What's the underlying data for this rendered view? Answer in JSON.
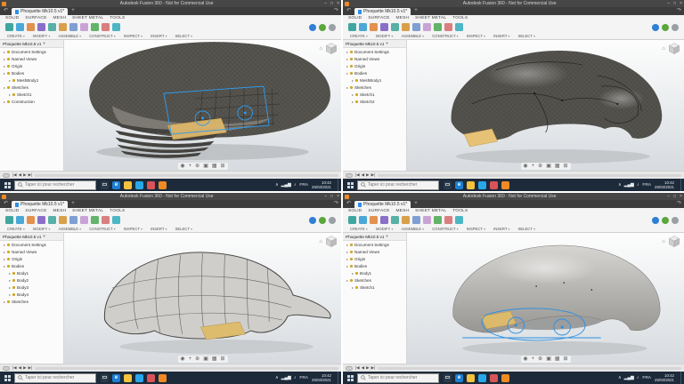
{
  "colors": {
    "fusion_orange": "#f08a24",
    "sketch_blue": "#2f9bef",
    "section_tan": "#dcb76b",
    "taskbar_navy": "#1d2a3a",
    "titlebar_gray": "#474747"
  },
  "titlebar": {
    "title": "Autodesk Fusion 360 - Not for Commercial Use",
    "buttons": [
      {
        "name": "minimize-button",
        "glyph": "–"
      },
      {
        "name": "maximize-button",
        "glyph": "□"
      },
      {
        "name": "close-button",
        "glyph": "×"
      }
    ]
  },
  "tabstrip": {
    "doc_tab": "Phoquette Mk10.5 v1*",
    "undo": "↶",
    "redo": "↷",
    "new_tab": "+"
  },
  "browser_header": "Phoquette Mk10.5 v1",
  "ribbon": {
    "tabs": [
      "SOLID",
      "SURFACE",
      "MESH",
      "SHEET METAL",
      "TOOLS"
    ],
    "groups": [
      "CREATE",
      "MODIFY",
      "ASSEMBLE",
      "CONSTRUCT",
      "INSPECT",
      "INSERT",
      "SELECT"
    ],
    "icons": [
      {
        "name": "new-design-tool-icon",
        "color": "#3fa7a0"
      },
      {
        "name": "box-tool-icon",
        "color": "#49a8d8"
      },
      {
        "name": "cylinder-tool-icon",
        "color": "#e3914e"
      },
      {
        "name": "form-tool-icon",
        "color": "#8a6fc9"
      },
      {
        "name": "extrude-tool-icon",
        "color": "#58b0a6"
      },
      {
        "name": "revolve-tool-icon",
        "color": "#d9a04b"
      },
      {
        "name": "sweep-tool-icon",
        "color": "#7f9fd4"
      },
      {
        "name": "mesh-tool-icon",
        "color": "#caa3d6"
      },
      {
        "name": "combine-tool-icon",
        "color": "#63b36a"
      },
      {
        "name": "section-tool-icon",
        "color": "#d97f7f"
      },
      {
        "name": "measure-tool-icon",
        "color": "#4db6c4"
      }
    ],
    "right_icons": [
      {
        "name": "extensions-icon",
        "color": "#2f7fd6"
      },
      {
        "name": "generative-icon",
        "color": "#5aa73c"
      },
      {
        "name": "help-icon",
        "color": "#9aa0a6"
      }
    ]
  },
  "viewport": {
    "nav_icons": [
      {
        "name": "orbit-icon",
        "glyph": "◉"
      },
      {
        "name": "pan-icon",
        "glyph": "+"
      },
      {
        "name": "zoom-icon",
        "glyph": "⊕"
      },
      {
        "name": "fit-icon",
        "glyph": "▣"
      },
      {
        "name": "display-settings-icon",
        "glyph": "▦"
      },
      {
        "name": "grid-snap-icon",
        "glyph": "⊞"
      }
    ]
  },
  "timeline": {
    "controls": [
      "|◀",
      "◀",
      "▶",
      "▶|"
    ]
  },
  "taskbar": {
    "search_placeholder": "Taper ici pour rechercher",
    "icons": [
      {
        "name": "task-view-icon",
        "color": "#2b3a4a",
        "glyph": "▭"
      },
      {
        "name": "edge-icon",
        "color": "#1b7fd4",
        "glyph": "e"
      },
      {
        "name": "file-explorer-icon",
        "color": "#f3c33e",
        "glyph": ""
      },
      {
        "name": "store-icon",
        "color": "#28a8ea",
        "glyph": ""
      },
      {
        "name": "photos-icon",
        "color": "#d95459",
        "glyph": ""
      },
      {
        "name": "fusion-app-icon",
        "color": "#f08a24",
        "glyph": ""
      }
    ],
    "tray_icons": [
      {
        "name": "tray-expand-icon",
        "glyph": "∧"
      },
      {
        "name": "network-icon",
        "glyph": "▂▄▆"
      },
      {
        "name": "volume-icon",
        "glyph": "♪"
      }
    ],
    "language": "FRA",
    "time": "10:42",
    "date": "25/03/2021"
  },
  "windows": [
    {
      "id": "top-left",
      "browser": {
        "items": [
          {
            "label": "Document Settings",
            "pad": "4px"
          },
          {
            "label": "Named Views",
            "pad": "4px"
          },
          {
            "label": "Origin",
            "pad": "4px"
          },
          {
            "label": "Bodies",
            "pad": "4px"
          },
          {
            "label": "MeshBody1",
            "pad": "10px"
          },
          {
            "label": "Sketches",
            "pad": "4px"
          },
          {
            "label": "Sketch1",
            "pad": "10px"
          },
          {
            "label": "Construction",
            "pad": "4px"
          }
        ]
      }
    },
    {
      "id": "top-right",
      "browser": {
        "items": [
          {
            "label": "Document Settings",
            "pad": "4px"
          },
          {
            "label": "Named Views",
            "pad": "4px"
          },
          {
            "label": "Origin",
            "pad": "4px"
          },
          {
            "label": "Bodies",
            "pad": "4px"
          },
          {
            "label": "MeshBody1",
            "pad": "10px"
          },
          {
            "label": "Sketches",
            "pad": "4px"
          },
          {
            "label": "Sketch1",
            "pad": "10px"
          },
          {
            "label": "Sketch2",
            "pad": "10px"
          }
        ]
      }
    },
    {
      "id": "bottom-left",
      "browser": {
        "items": [
          {
            "label": "Document Settings",
            "pad": "4px"
          },
          {
            "label": "Named Views",
            "pad": "4px"
          },
          {
            "label": "Origin",
            "pad": "4px"
          },
          {
            "label": "Bodies",
            "pad": "4px"
          },
          {
            "label": "Body1",
            "pad": "10px"
          },
          {
            "label": "Body2",
            "pad": "10px"
          },
          {
            "label": "Body3",
            "pad": "10px"
          },
          {
            "label": "Body4",
            "pad": "10px"
          },
          {
            "label": "Sketches",
            "pad": "4px"
          }
        ]
      }
    },
    {
      "id": "bottom-right",
      "browser": {
        "items": [
          {
            "label": "Document Settings",
            "pad": "4px"
          },
          {
            "label": "Named Views",
            "pad": "4px"
          },
          {
            "label": "Origin",
            "pad": "4px"
          },
          {
            "label": "Bodies",
            "pad": "4px"
          },
          {
            "label": "Body1",
            "pad": "10px"
          },
          {
            "label": "Sketches",
            "pad": "4px"
          },
          {
            "label": "Sketch1",
            "pad": "10px"
          }
        ]
      }
    }
  ]
}
